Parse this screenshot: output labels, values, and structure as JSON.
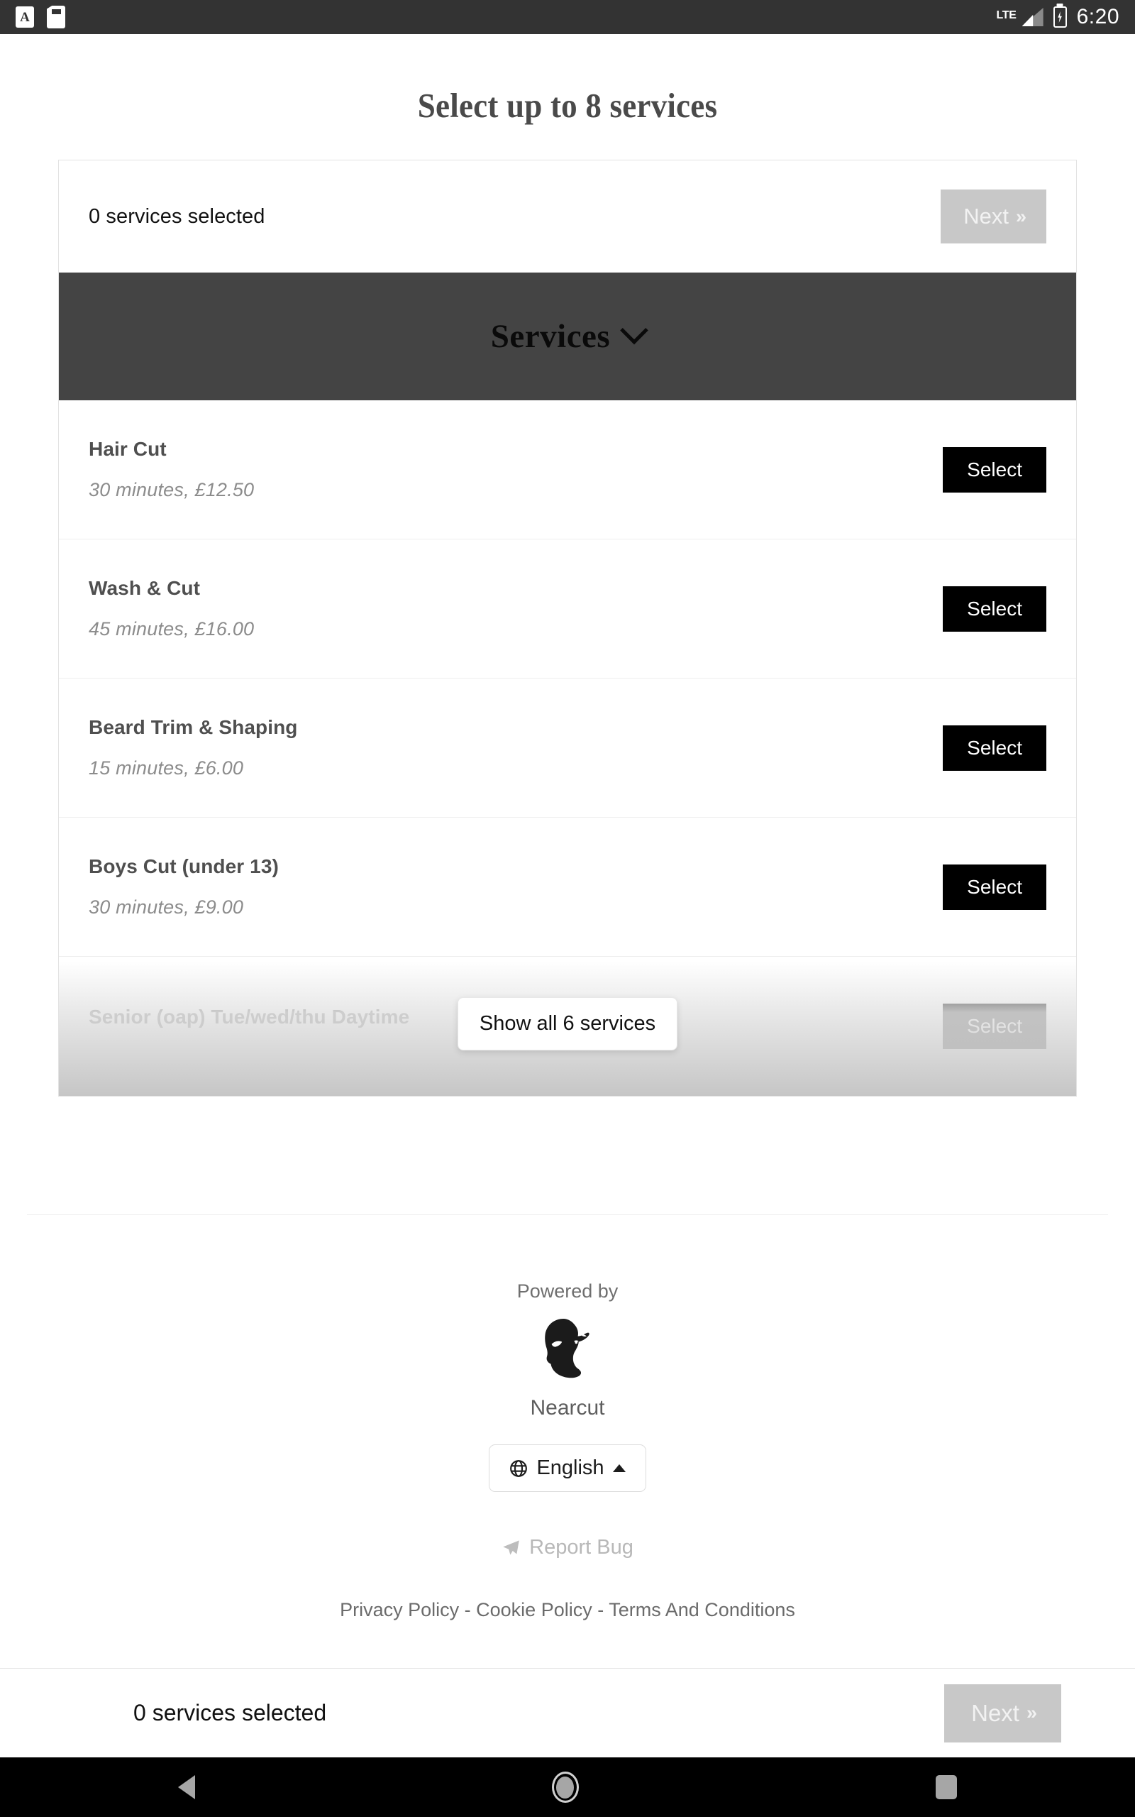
{
  "statusbar": {
    "icons": [
      "keyboard-language-icon",
      "sd-card-icon"
    ],
    "keyboard_glyph": "A",
    "network_label": "LTE",
    "signal_icon": "signal-bars-icon",
    "battery_icon": "battery-charging-icon",
    "time": "6:20"
  },
  "header": {
    "title": "Select up to 8 services"
  },
  "selection_bar": {
    "count_text": "0 services selected",
    "next_label": "Next",
    "next_chevron": "»",
    "next_enabled": false
  },
  "services_section": {
    "title": "Services",
    "chevron": "chevron-down-icon",
    "select_label": "Select",
    "items": [
      {
        "name": "Hair Cut",
        "meta": "30 minutes, £12.50",
        "action": "Select",
        "faded": false
      },
      {
        "name": "Wash & Cut",
        "meta": "45 minutes, £16.00",
        "action": "Select",
        "faded": false
      },
      {
        "name": "Beard Trim & Shaping",
        "meta": "15 minutes, £6.00",
        "action": "Select",
        "faded": false
      },
      {
        "name": "Boys Cut (under 13)",
        "meta": "30 minutes, £9.00",
        "action": "Select",
        "faded": false
      },
      {
        "name": "Senior (oap) Tue/wed/thu Daytime",
        "meta": "",
        "action": "Select",
        "faded": true
      }
    ],
    "show_all_label": "Show all 6 services"
  },
  "footer": {
    "powered_by": "Powered by",
    "brand_name": "Nearcut",
    "brand_logo": "bearded-man-logo",
    "language": {
      "icon": "globe-icon",
      "label": "English",
      "caret": "caret-up-icon"
    },
    "report_bug": {
      "icon": "paper-plane-icon",
      "label": "Report Bug"
    },
    "legal_links": [
      "Privacy Policy",
      "Cookie Policy",
      "Terms And Conditions"
    ],
    "legal_separator": " - "
  },
  "sticky_bar": {
    "count_text": "0 services selected",
    "next_label": "Next",
    "next_chevron": "»",
    "next_enabled": false
  },
  "navbar": {
    "back": "back-nav-icon",
    "home": "home-nav-icon",
    "recents": "recents-nav-icon"
  },
  "colors": {
    "status_bar_bg": "#333333",
    "services_header_bg": "#444444",
    "select_button_bg": "#000000",
    "next_disabled_bg": "#c8c8c8",
    "page_bg": "#ffffff"
  }
}
